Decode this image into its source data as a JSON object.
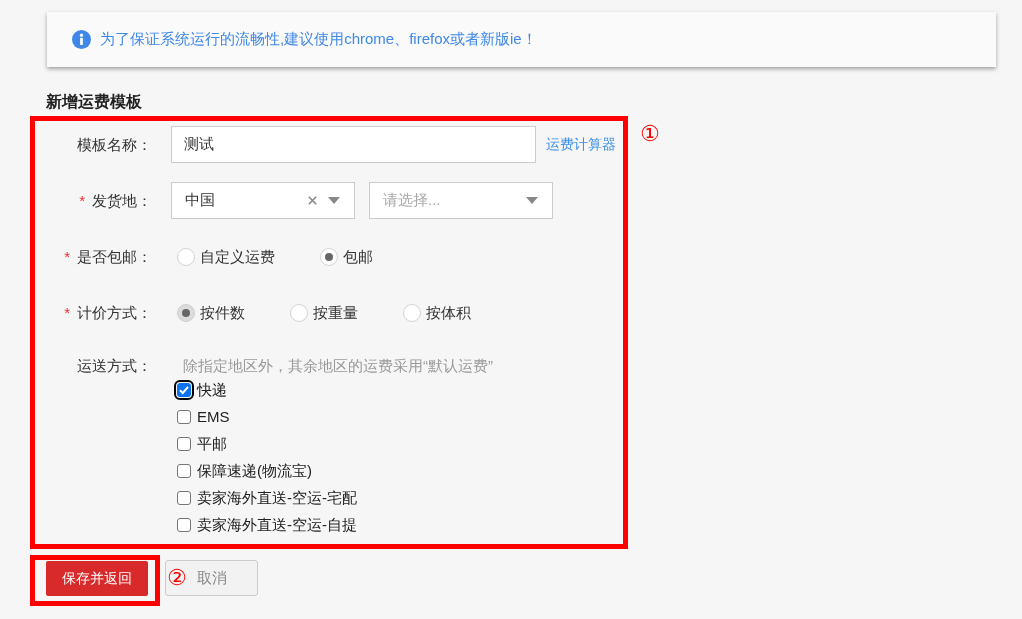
{
  "notice": {
    "text": "为了保证系统运行的流畅性,建议使用chrome、firefox或者新版ie！"
  },
  "title": "新增运费模板",
  "form": {
    "marker": "①",
    "fields": [
      {
        "kind": "text",
        "label": "模板名称：",
        "value": "测试",
        "link": "运费计算器"
      },
      {
        "kind": "select",
        "label": "发货地：",
        "required_mark": "*",
        "selects": [
          {
            "value": "中国",
            "clearable": true
          },
          {
            "placeholder": "请选择..."
          }
        ]
      },
      {
        "kind": "radio",
        "label": "是否包邮：",
        "required_mark": "*",
        "options": [
          {
            "label": "自定义运费",
            "selected": false,
            "focused": false
          },
          {
            "label": "包邮",
            "selected": true,
            "focused": false
          }
        ]
      },
      {
        "kind": "radio",
        "label": "计价方式：",
        "required_mark": "*",
        "options": [
          {
            "label": "按件数",
            "selected": true,
            "focused": true
          },
          {
            "label": "按重量",
            "selected": false,
            "focused": false
          },
          {
            "label": "按体积",
            "selected": false,
            "focused": false
          }
        ]
      },
      {
        "kind": "checkbox",
        "label": "运送方式：",
        "hint": "除指定地区外，其余地区的运费采用“默认运费”",
        "options": [
          {
            "label": "快递",
            "checked": true,
            "focused": true
          },
          {
            "label": "EMS",
            "checked": false,
            "focused": false
          },
          {
            "label": "平邮",
            "checked": false,
            "focused": false
          },
          {
            "label": "保障速递(物流宝)",
            "checked": false,
            "focused": false
          },
          {
            "label": "卖家海外直送-空运-宅配",
            "checked": false,
            "focused": false
          },
          {
            "label": "卖家海外直送-空运-自提",
            "checked": false,
            "focused": false
          }
        ]
      }
    ]
  },
  "actions": {
    "marker": "②",
    "buttons": [
      {
        "label": "保存并返回",
        "kind": "primary"
      },
      {
        "label": "取消",
        "kind": "default"
      }
    ]
  }
}
